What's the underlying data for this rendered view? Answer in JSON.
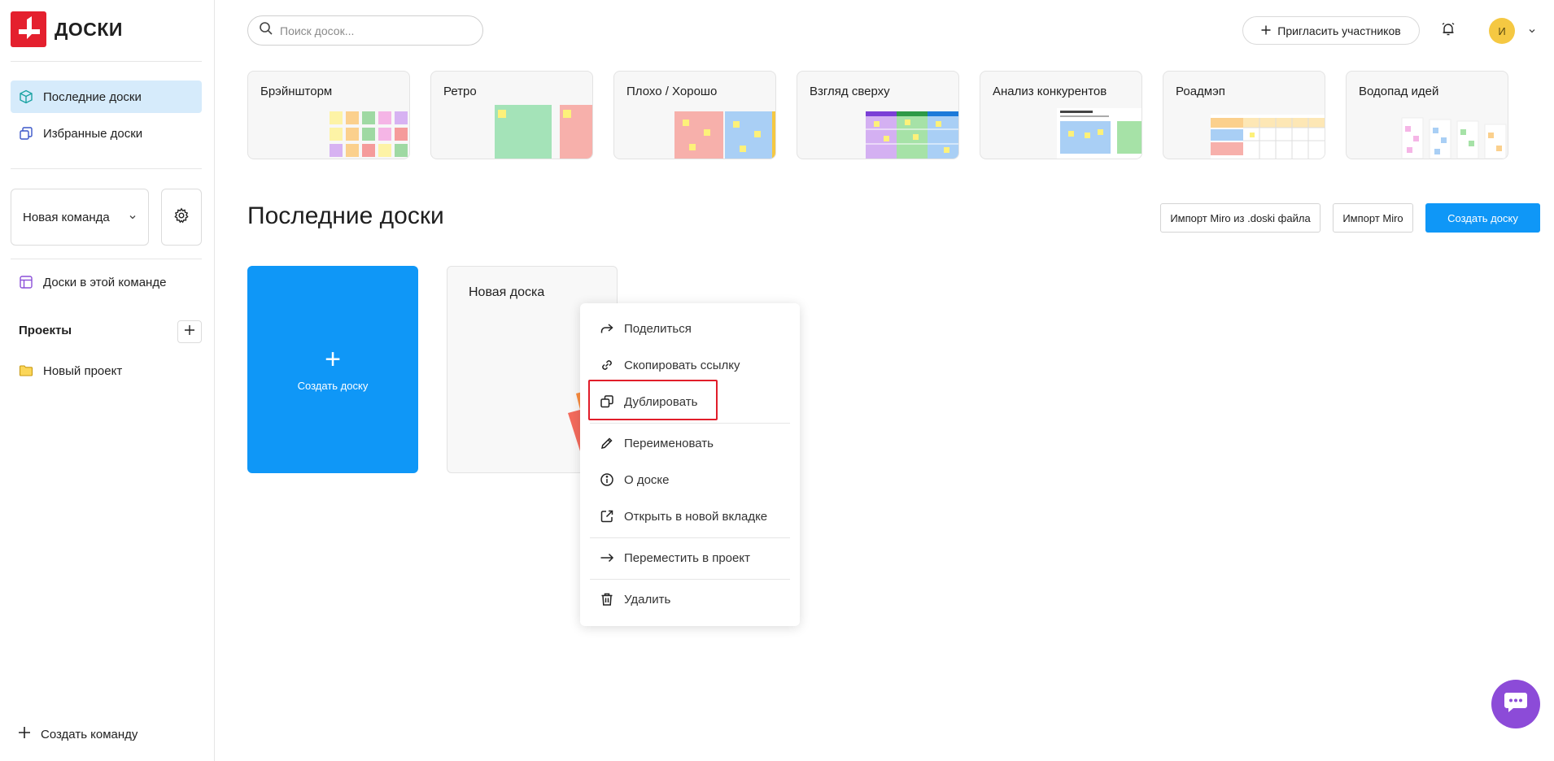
{
  "app": {
    "logo_text": "ДОСКИ",
    "accent": "#0f97f7",
    "brand": "#e4202e"
  },
  "sidebar": {
    "nav": [
      {
        "label": "Последние доски",
        "icon": "cube-icon",
        "active": true
      },
      {
        "label": "Избранные доски",
        "icon": "copy-stack-icon",
        "active": false
      }
    ],
    "team": {
      "name": "Новая команда"
    },
    "team_boards_label": "Доски в этой команде",
    "projects_title": "Проекты",
    "projects": [
      {
        "label": "Новый проект",
        "icon": "folder-icon"
      }
    ],
    "create_team_label": "Создать команду"
  },
  "header": {
    "search_placeholder": "Поиск досок...",
    "invite_label": "Пригласить участников",
    "avatar_initial": "И"
  },
  "templates": [
    {
      "name": "Брэйншторм"
    },
    {
      "name": "Ретро"
    },
    {
      "name": "Плохо / Хорошо"
    },
    {
      "name": "Взгляд сверху"
    },
    {
      "name": "Анализ конкурентов"
    },
    {
      "name": "Роадмэп"
    },
    {
      "name": "Водопад идей"
    }
  ],
  "main": {
    "title": "Последние доски",
    "import_doski_label": "Импорт Miro из .doski файла",
    "import_miro_label": "Импорт Miro",
    "create_board_label": "Создать доску",
    "create_card_label": "Создать доску",
    "boards": [
      {
        "title": "Новая доска"
      }
    ]
  },
  "context_menu": {
    "items": [
      {
        "label": "Поделиться",
        "icon": "share-icon"
      },
      {
        "label": "Скопировать ссылку",
        "icon": "link-icon"
      },
      {
        "label": "Дублировать",
        "icon": "duplicate-icon",
        "highlighted": true
      },
      {
        "label": "Переименовать",
        "icon": "pencil-icon"
      },
      {
        "label": "О доске",
        "icon": "info-icon"
      },
      {
        "label": "Открыть в новой вкладке",
        "icon": "external-link-icon"
      },
      {
        "label": "Переместить в проект",
        "icon": "arrow-right-icon"
      },
      {
        "label": "Удалить",
        "icon": "trash-icon"
      }
    ]
  }
}
